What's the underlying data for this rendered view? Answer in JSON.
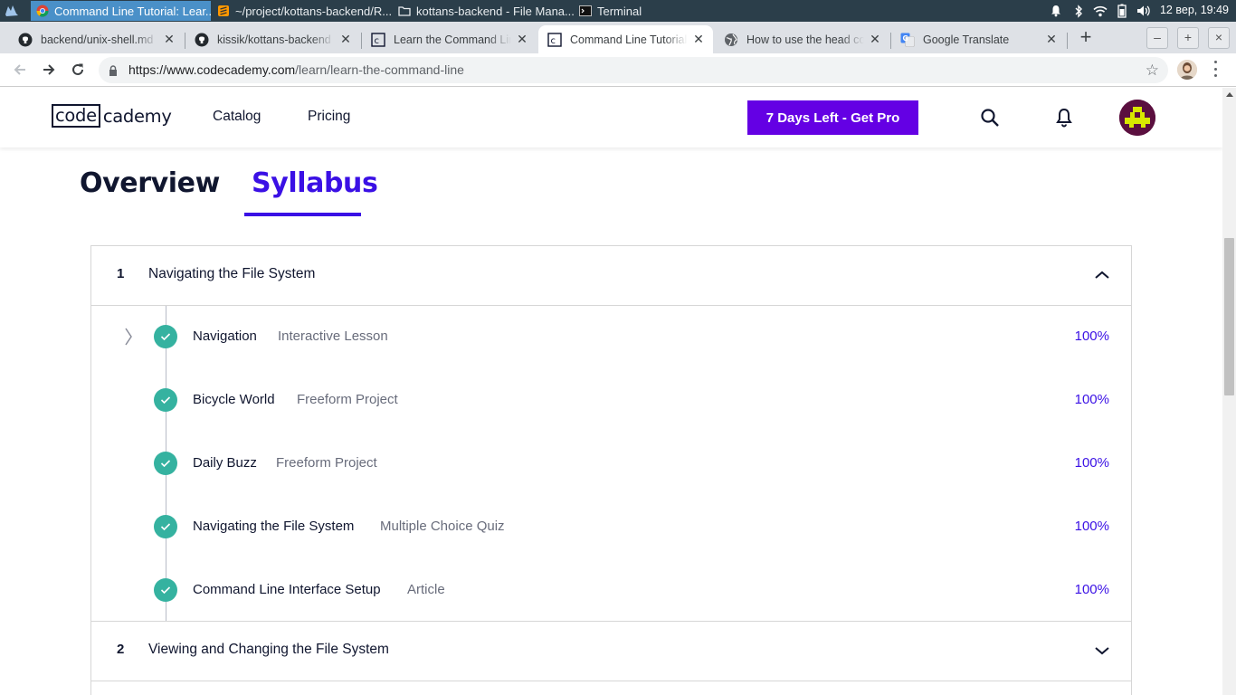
{
  "taskbar": {
    "tasks": [
      {
        "label": "Command Line Tutorial: Lear...",
        "icon": "chrome-icon",
        "active": true
      },
      {
        "label": "~/project/kottans-backend/R...",
        "icon": "sublime-text-icon",
        "active": false
      },
      {
        "label": "kottans-backend - File Mana...",
        "icon": "folder-icon",
        "active": false
      },
      {
        "label": "Terminal",
        "icon": "terminal-icon",
        "active": false
      }
    ],
    "clock": "12 вер, 19:49",
    "tray_icons": [
      "notification-bell-icon",
      "bluetooth-icon",
      "wifi-icon",
      "battery-icon",
      "volume-icon"
    ]
  },
  "browser": {
    "tabs": [
      {
        "title": "backend/unix-shell.md",
        "icon": "github-icon"
      },
      {
        "title": "kissik/kottans-backend",
        "icon": "github-icon"
      },
      {
        "title": "Learn the Command Line",
        "icon": "codecademy-icon"
      },
      {
        "title": "Command Line Tutorial",
        "icon": "codecademy-icon",
        "active": true
      },
      {
        "title": "How to use the head co",
        "icon": "globe-icon"
      },
      {
        "title": "Google Translate",
        "icon": "google-translate-icon"
      }
    ],
    "new_tab_label": "+",
    "window_controls": [
      "–",
      "+",
      "×"
    ],
    "url_scheme_host": "https://www.codecademy.com",
    "url_path": "/learn/learn-the-command-line"
  },
  "site": {
    "logo_box": "code",
    "logo_rest": "cademy",
    "nav": [
      "Catalog",
      "Pricing"
    ],
    "pro_button": "7 Days Left - Get Pro"
  },
  "page_tabs": {
    "overview": "Overview",
    "syllabus": "Syllabus"
  },
  "units": [
    {
      "number": "1",
      "title": "Navigating the File System",
      "expanded": true,
      "lessons": [
        {
          "name": "Navigation",
          "type": "Interactive Lesson",
          "progress": "100%"
        },
        {
          "name": "Bicycle World",
          "type": "Freeform Project",
          "progress": "100%"
        },
        {
          "name": "Daily Buzz",
          "type": "Freeform Project",
          "progress": "100%"
        },
        {
          "name": "Navigating the File System",
          "type": "Multiple Choice Quiz",
          "progress": "100%"
        },
        {
          "name": "Command Line Interface Setup",
          "type": "Article",
          "progress": "100%"
        }
      ]
    },
    {
      "number": "2",
      "title": "Viewing and Changing the File System",
      "expanded": false
    }
  ],
  "colors": {
    "accent": "#3a10e5",
    "pro_button": "#6400e4",
    "check": "#35b2a0",
    "text": "#10162f"
  }
}
